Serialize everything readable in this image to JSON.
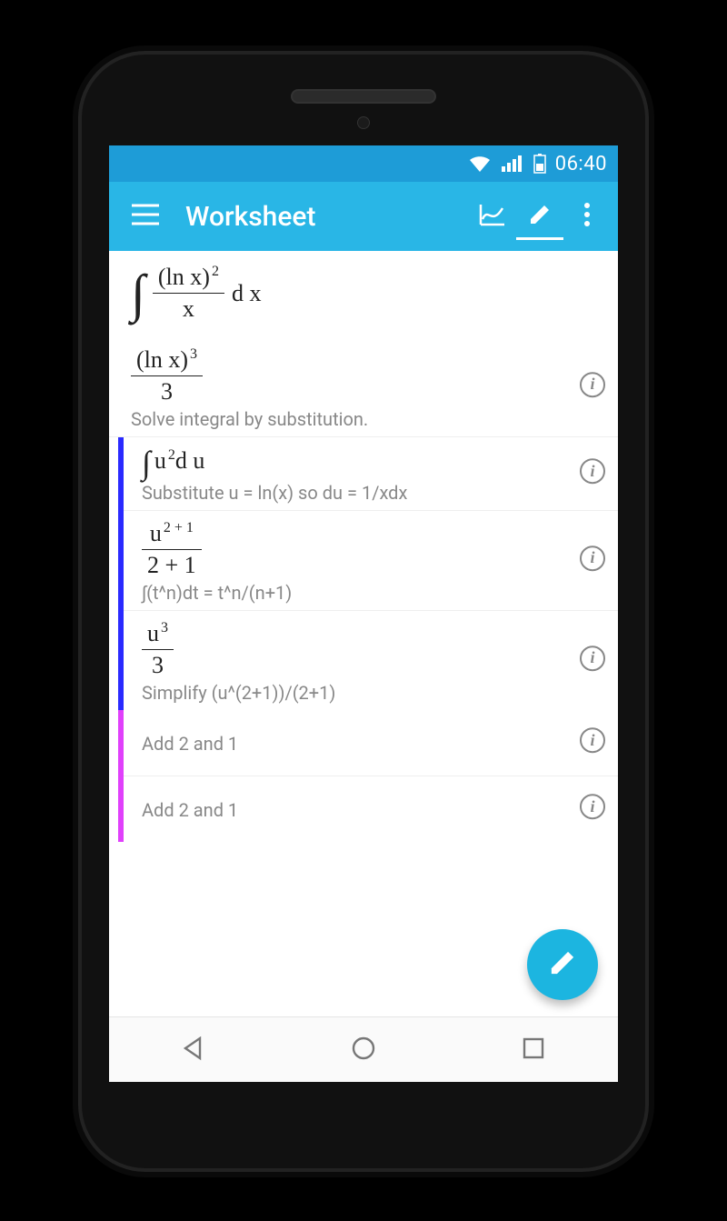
{
  "status": {
    "time": "06:40"
  },
  "appbar": {
    "title": "Worksheet",
    "menu_icon": "hamburger-icon",
    "graph_icon": "graph-icon",
    "edit_icon": "pencil-icon",
    "overflow_icon": "more-vert-icon"
  },
  "problem": {
    "integrand_num": "(ln x)",
    "integrand_num_exp": "2",
    "integrand_den": "x",
    "differential": "d x"
  },
  "result": {
    "num_base": "(ln x)",
    "num_exp": "3",
    "den": "3",
    "caption": "Solve integral by substitution."
  },
  "steps": [
    {
      "kind": "expr-line",
      "expr_prefix": "∫",
      "expr_base": "u",
      "expr_exp": "2",
      "expr_suffix": "d u",
      "caption": "Substitute u = ln(x) so du = 1/xdx"
    },
    {
      "kind": "frac",
      "num_base": "u",
      "num_exp": "2 + 1",
      "den": "2 + 1",
      "caption": "∫(t^n)dt = t^n/(n+1)"
    },
    {
      "kind": "frac",
      "num_base": "u",
      "num_exp": "3",
      "den": "3",
      "caption": "Simplify (u^(2+1))/(2+1)"
    }
  ],
  "substeps": [
    {
      "caption": "Add 2 and 1"
    },
    {
      "caption": "Add 2 and 1"
    }
  ],
  "info_glyph": "i",
  "fab_icon": "pencil-icon",
  "nav": {
    "back": "back-icon",
    "home": "home-icon",
    "recent": "recent-icon"
  }
}
